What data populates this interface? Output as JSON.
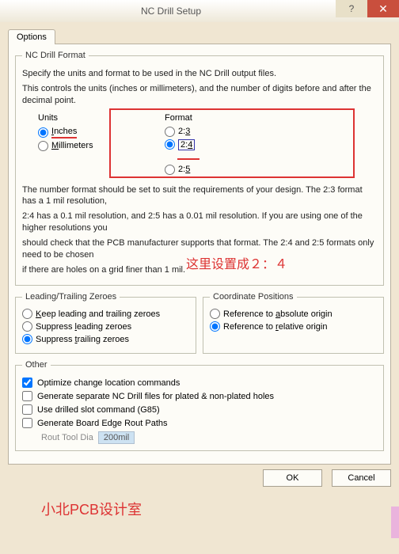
{
  "title": "NC Drill Setup",
  "tab": "Options",
  "fmt": {
    "legend": "NC Drill Format",
    "p1": "Specify the units and format to be used in the NC Drill output files.",
    "p2": "This controls the units (inches or millimeters), and the number of digits before and after the decimal point.",
    "units_label": "Units",
    "format_label": "Format",
    "inches": "Inches",
    "mm": "Millimeters",
    "f23": "2:3",
    "f24": "2:4",
    "f25": "2:5",
    "p3a": "The number format should be set to suit the requirements of your design. The 2:3 format has a 1 mil resolution,",
    "p3b": "2:4 has a 0.1 mil resolution, and 2:5 has a 0.01 mil resolution. If you are using one of the higher resolutions you",
    "p3c": "should check that the PCB manufacturer supports that format. The 2:4 and 2:5 formats only need to be chosen",
    "p3d": "if there are holes on a grid finer than 1 mil."
  },
  "zeros": {
    "legend": "Leading/Trailing Zeroes",
    "keep": "Keep leading and trailing zeroes",
    "supL": "Suppress leading zeroes",
    "supT": "Suppress trailing zeroes"
  },
  "coord": {
    "legend": "Coordinate Positions",
    "abs": "Reference to absolute origin",
    "rel": "Reference to relative origin"
  },
  "other": {
    "legend": "Other",
    "opt": "Optimize change location commands",
    "sep": "Generate separate NC Drill files for plated & non-plated holes",
    "g85": "Use drilled slot command (G85)",
    "rout": "Generate Board Edge Rout Paths",
    "routtool": "Rout Tool Dia",
    "routval": "200mil"
  },
  "buttons": {
    "ok": "OK",
    "cancel": "Cancel"
  },
  "annot": {
    "a1": "这里设置成２：４",
    "a2": "小北PCB设计室"
  }
}
